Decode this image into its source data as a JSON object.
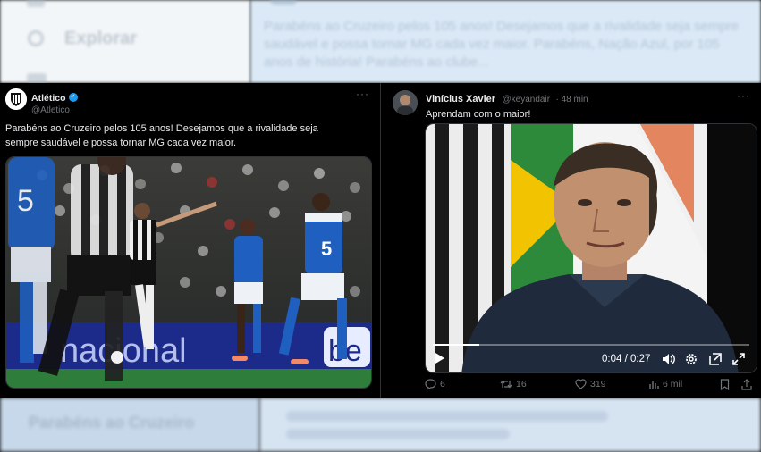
{
  "background": {
    "nav_explore": "Explorar",
    "top_right_text": "Parabéns ao Cruzeiro pelos 105 anos! Desejamos que a rivalidade seja sempre saudável e possa tornar MG cada vez maior. Parabéns, Nação Azul, por 105 anos de história! Parabéns ao clube...",
    "bottom_left_text": "Parabéns ao Cruzeiro"
  },
  "left_tweet": {
    "author_name": "Atlético",
    "handle": "@Atletico",
    "text": "Parabéns ao Cruzeiro pelos 105 anos! Desejamos que a rivalidade seja sempre saudável e possa tornar MG cada vez maior.",
    "more": "···",
    "banner_text": "nacional",
    "banner_text2": "be",
    "player5_number": "5"
  },
  "right_tweet": {
    "author_name": "Vinícius Xavier",
    "handle": "@keyandair",
    "time": "· 48 min",
    "text": "Aprendam com o maior!",
    "more": "···",
    "video": {
      "current_time": "0:04",
      "duration": "0:27",
      "progress": 0.148
    },
    "actions": {
      "replies": "6",
      "retweets": "16",
      "likes": "319",
      "views": "6 mil"
    }
  },
  "colors": {
    "accent": "#1d9bf0",
    "cruzeiro_blue": "#1f5fbf",
    "pitch_green": "#2f7d3a"
  }
}
